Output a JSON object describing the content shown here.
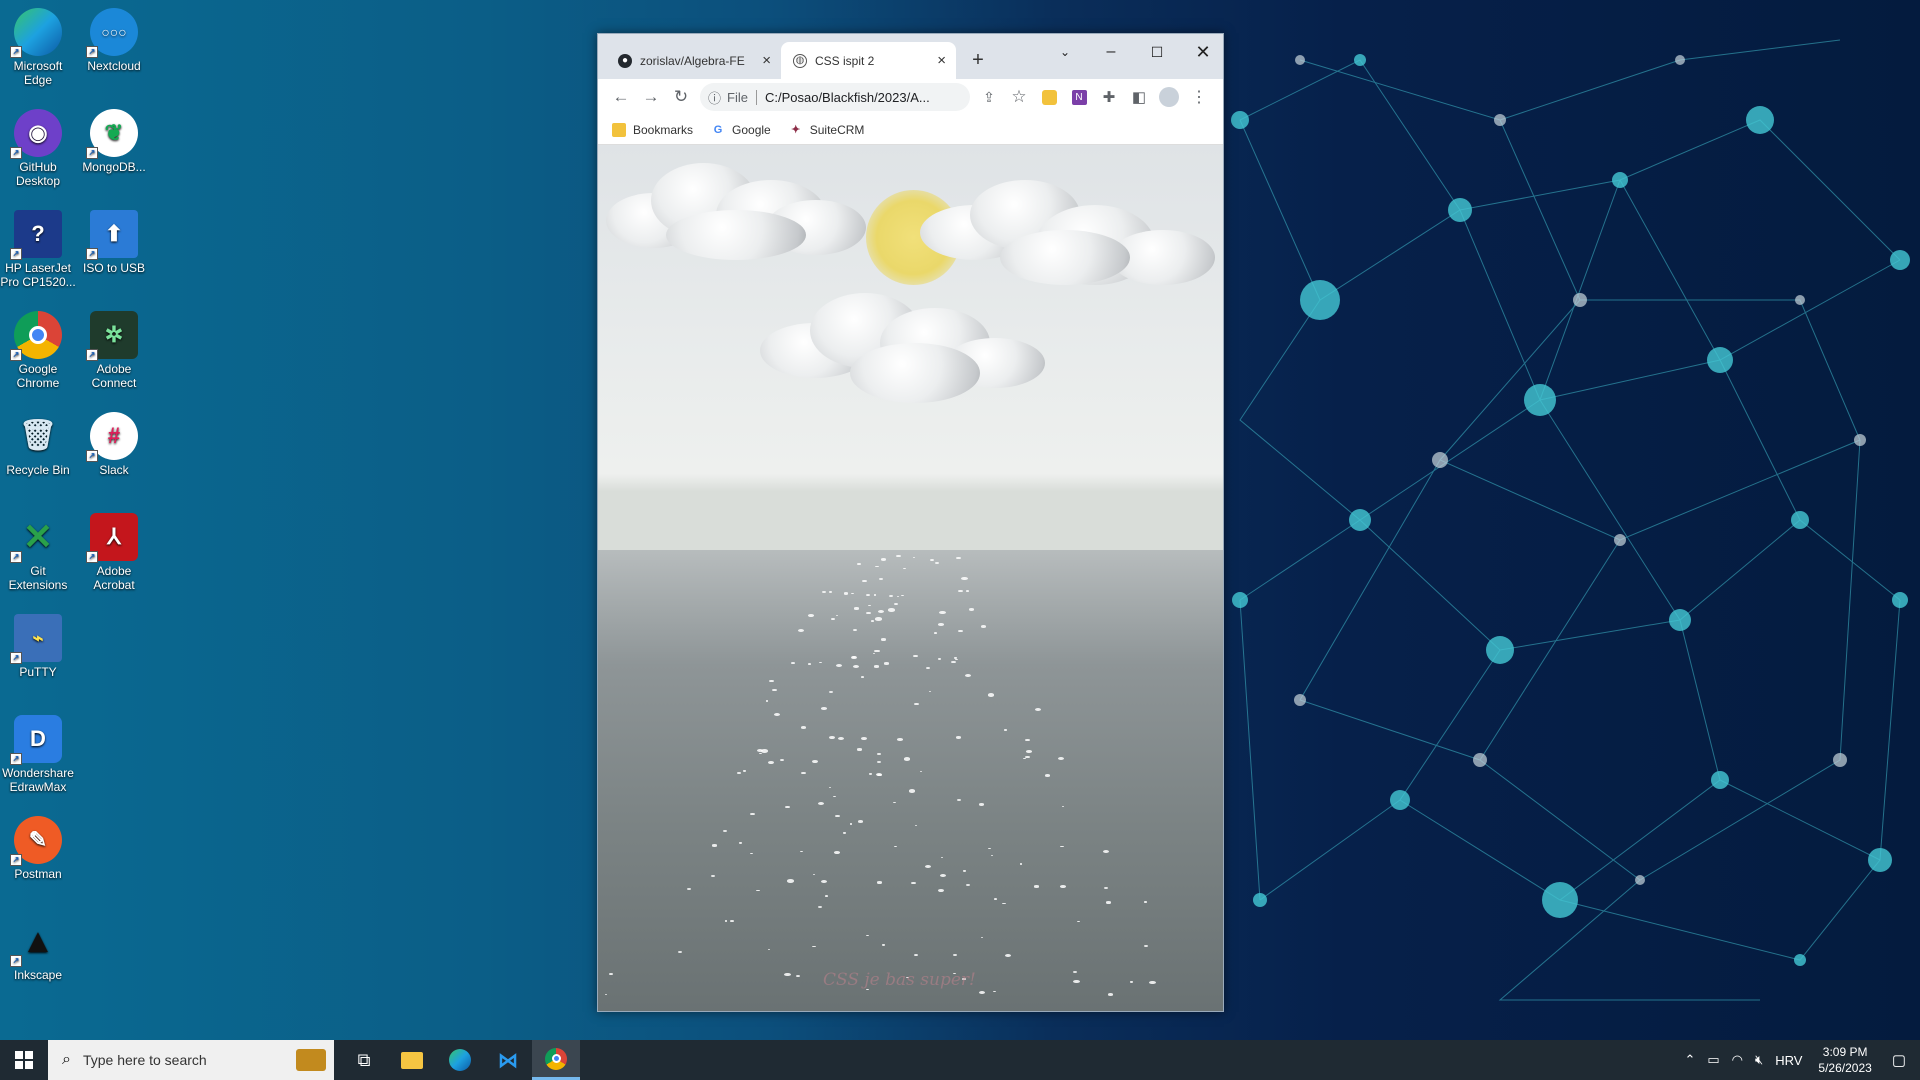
{
  "desktop": {
    "icons": [
      {
        "label": "Microsoft Edge",
        "icon": "edge-icon",
        "color": "#1da1e0"
      },
      {
        "label": "Nextcloud",
        "icon": "nextcloud-icon",
        "color": "#1b88d8"
      },
      {
        "label": "GitHub Desktop",
        "icon": "github-icon",
        "color": "#6e40c9"
      },
      {
        "label": "MongoDB...",
        "icon": "mongodb-icon",
        "color": "#ffffff"
      },
      {
        "label": "HP LaserJet Pro CP1520...",
        "icon": "printer-icon",
        "color": "#1c3a8a"
      },
      {
        "label": "ISO to USB",
        "icon": "usb-icon",
        "color": "#2b7bd6"
      },
      {
        "label": "Google Chrome",
        "icon": "chrome-icon",
        "color": "#ffffff"
      },
      {
        "label": "Adobe Connect",
        "icon": "adobe-connect-icon",
        "color": "#1f3b2c"
      },
      {
        "label": "Recycle Bin",
        "icon": "recycle-bin-icon",
        "color": "#9fc7e0"
      },
      {
        "label": "Slack",
        "icon": "slack-icon",
        "color": "#ffffff"
      },
      {
        "label": "Git Extensions",
        "icon": "git-extensions-icon",
        "color": "#2aa14a"
      },
      {
        "label": "Adobe Acrobat",
        "icon": "acrobat-icon",
        "color": "#c4161c"
      },
      {
        "label": "PuTTY",
        "icon": "putty-icon",
        "color": "#3a6fb8"
      },
      {
        "label": "Wondershare EdrawMax",
        "icon": "edrawmax-icon",
        "color": "#2a7de1"
      },
      {
        "label": "Postman",
        "icon": "postman-icon",
        "color": "#ef5b25"
      },
      {
        "label": "Inkscape",
        "icon": "inkscape-icon",
        "color": "#222222"
      }
    ]
  },
  "browser": {
    "tabs": [
      {
        "title": "zorislav/Algebra-FE",
        "icon": "github-icon"
      },
      {
        "title": "CSS ispit 2",
        "icon": "globe-icon"
      }
    ],
    "new_tab": "+",
    "address": {
      "scheme": "File",
      "url": "C:/Posao/Blackfish/2023/A..."
    },
    "bookmarks": [
      {
        "label": "Bookmarks",
        "icon": "folder-icon"
      },
      {
        "label": "Google",
        "icon": "google-icon"
      },
      {
        "label": "SuiteCRM",
        "icon": "suitecrm-icon"
      }
    ]
  },
  "page": {
    "watermark": "CSS je bas super!"
  },
  "taskbar": {
    "search_placeholder": "Type here to search",
    "language": "HRV",
    "time": "3:09 PM",
    "date": "5/26/2023"
  },
  "colors": {
    "taskbar_bg": "#1f2a33",
    "tabstrip_bg": "#dee3ea",
    "accent": "#76b9ed"
  }
}
